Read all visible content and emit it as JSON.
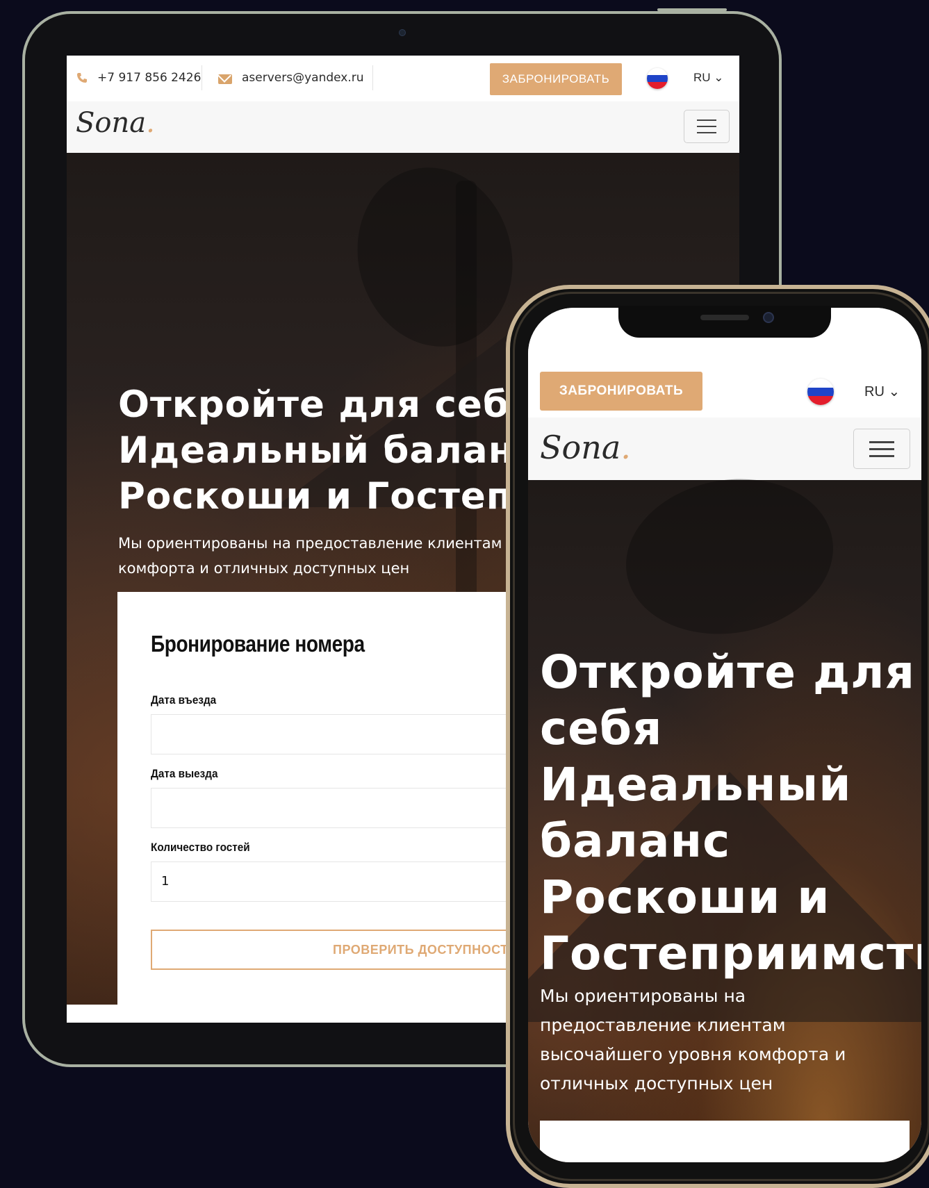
{
  "tablet": {
    "topbar": {
      "phone_icon": "phone-icon",
      "phone": "+7 917 856 2426",
      "email_icon": "envelope-icon",
      "email": "aservers@yandex.ru",
      "book_label": "ЗАБРОНИРОВАТЬ",
      "flag_icon": "russia-flag-icon",
      "language": "RU ⌄"
    },
    "navbar": {
      "logo_text": "Sona",
      "logo_dot": ".",
      "menu_icon": "hamburger-menu-icon"
    },
    "hero": {
      "title": "Откройте для себя Идеальный баланс Роскоши и Гостеприимства",
      "subtitle": "Мы ориентированы на предоставление клиентам высочайшего уровня комфорта и отличных доступных цен"
    },
    "booking": {
      "title": "Бронирование номера",
      "checkin_label": "Дата въезда",
      "checkin_value": "",
      "checkout_label": "Дата выезда",
      "checkout_value": "",
      "guests_label": "Количество гостей",
      "guests_value": "1",
      "check_button": "ПРОВЕРИТЬ ДОСТУПНОСТЬ"
    }
  },
  "phone": {
    "topbar": {
      "book_label": "ЗАБРОНИРОВАТЬ",
      "flag_icon": "russia-flag-icon",
      "language": "RU ⌄"
    },
    "navbar": {
      "logo_text": "Sona",
      "logo_dot": ".",
      "menu_icon": "hamburger-menu-icon"
    },
    "hero": {
      "title": "Откройте для себя Идеальный баланс Роскоши и Гостеприимства",
      "subtitle": "Мы ориентированы на предоставление клиентам высочайшего уровня комфорта и отличных доступных цен"
    }
  },
  "colors": {
    "accent": "#dfa974",
    "background": "#0b0b1c",
    "tablet_bezel": "#a9b1a2",
    "phone_bezel": "#c7b393"
  }
}
